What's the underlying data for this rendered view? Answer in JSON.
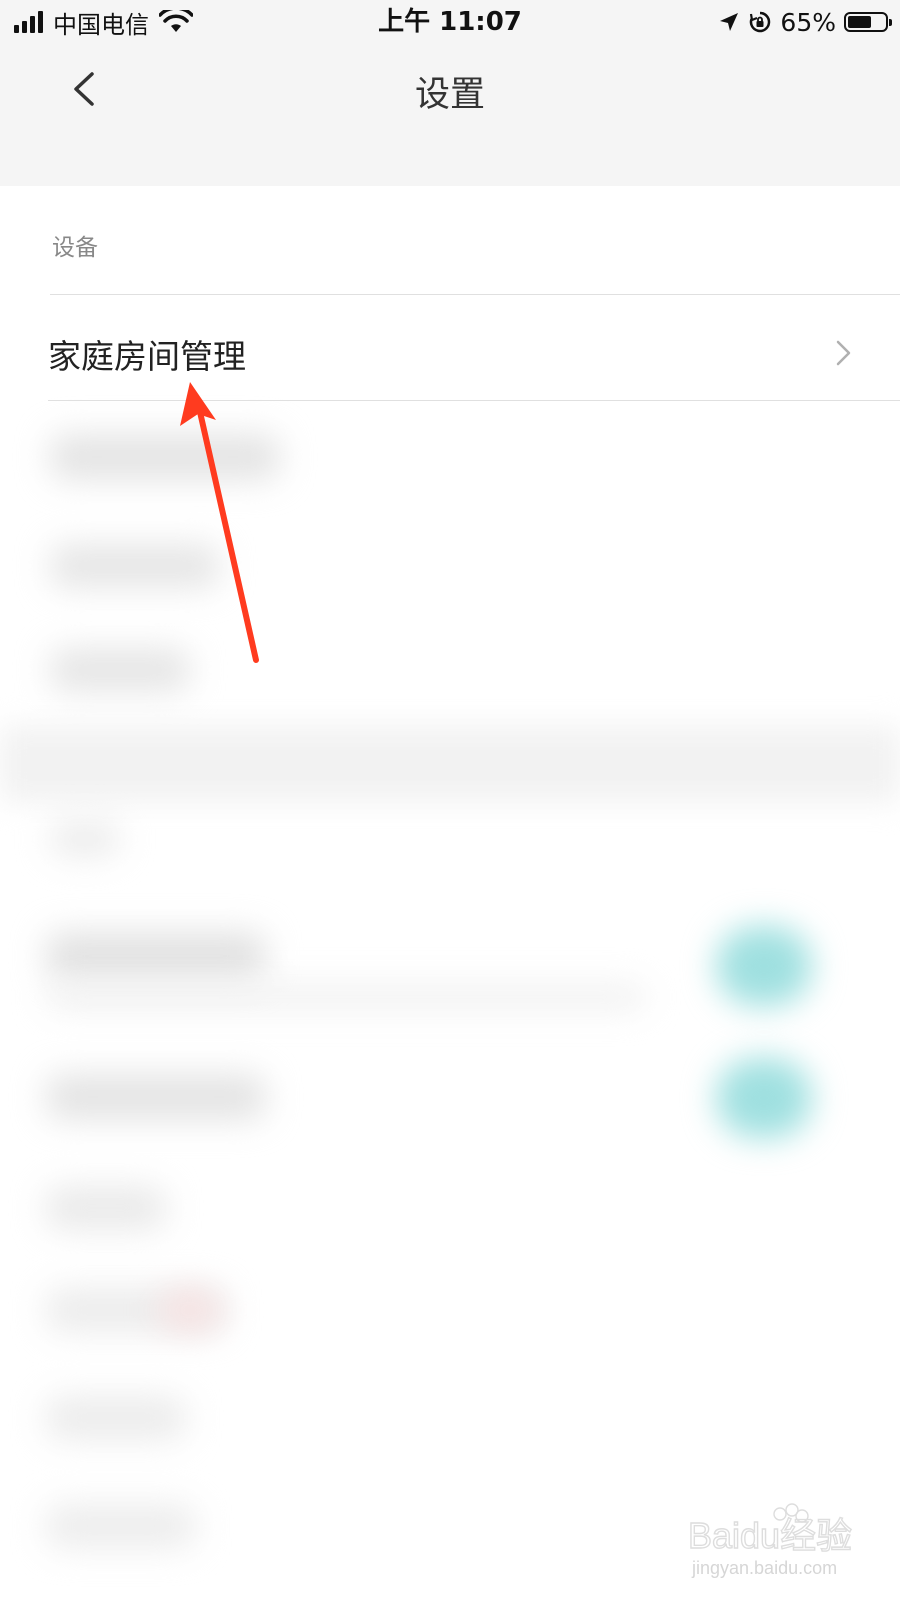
{
  "status_bar": {
    "carrier": "中国电信",
    "time": "上午 11:07",
    "battery_percent_text": "65%",
    "battery_level": 0.65,
    "icons": [
      "signal-icon",
      "wifi-icon",
      "location-arrow-icon",
      "rotation-lock-icon",
      "battery-icon"
    ]
  },
  "header": {
    "title": "设置",
    "back_icon": "chevron-left-icon"
  },
  "section": {
    "label": "设备",
    "items": [
      {
        "label": "家庭房间管理",
        "icon": "chevron-right-icon"
      }
    ]
  },
  "annotation": {
    "type": "red-arrow",
    "color": "#ff3b1f"
  },
  "watermark": {
    "logo_text": "Baidu经验",
    "url": "jingyan.baidu.com"
  },
  "colors": {
    "header_bg": "#f5f5f5",
    "page_bg": "#ffffff",
    "toggle_teal": "#9fe0e0",
    "arrow_red": "#ff3b1f"
  }
}
